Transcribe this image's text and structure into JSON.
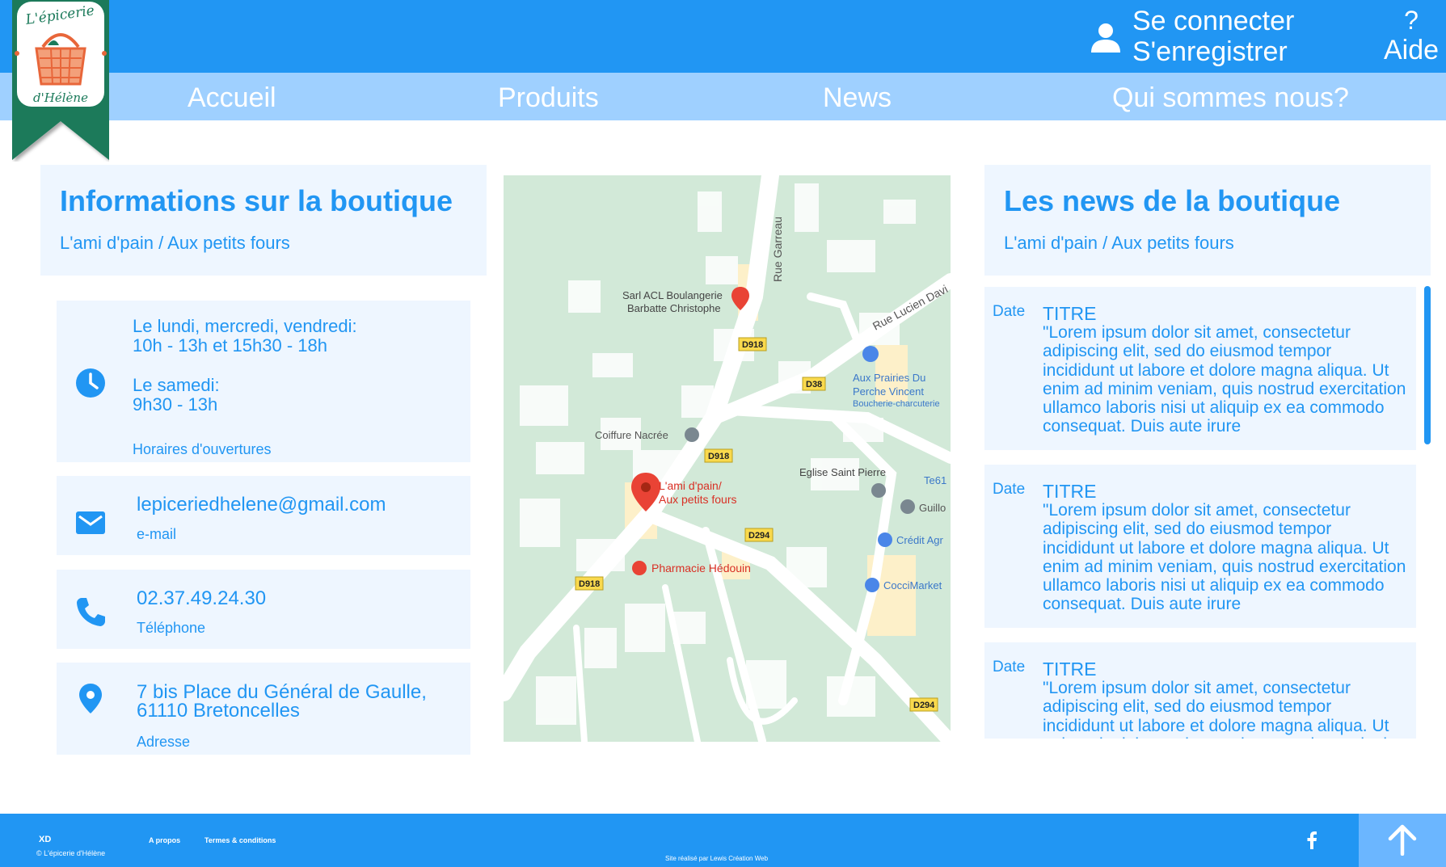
{
  "header": {
    "login_label": "Se connecter",
    "register_label": "S'enregistrer",
    "help_symbol": "?",
    "help_label": "Aide",
    "user_icon": "user-icon"
  },
  "nav": {
    "items": [
      "Accueil",
      "Produits",
      "News",
      "Qui sommes nous?"
    ]
  },
  "logo": {
    "line1": "L'épicerie",
    "line2": "d'Hélène"
  },
  "info": {
    "title": "Informations sur la boutique",
    "subtitle": "L'ami d'pain / Aux petits fours",
    "hours": {
      "line1": "Le lundi, mercredi, vendredi:",
      "line2": "10h - 13h et 15h30 - 18h",
      "line3": "Le samedi:",
      "line4": "9h30 - 13h",
      "caption": "Horaires d'ouvertures",
      "icon": "clock-icon"
    },
    "email": {
      "value": "lepiceriedhelene@gmail.com",
      "caption": "e-mail",
      "icon": "mail-icon"
    },
    "phone": {
      "value": "02.37.49.24.30",
      "caption": "Téléphone",
      "icon": "phone-icon"
    },
    "address": {
      "line1": "7 bis Place du Général de Gaulle,",
      "line2": "61110 Bretoncelles",
      "caption": "Adresse",
      "icon": "location-pin-icon"
    }
  },
  "map": {
    "street_garreau": "Rue Garreau",
    "street_lucien": "Rue Lucien Davi",
    "road_d918": "D918",
    "road_d38": "D38",
    "road_d294": "D294",
    "poi_boulangerie_1": "Sarl ACL Boulangerie",
    "poi_boulangerie_2": "Barbatte Christophe",
    "poi_prairies_1": "Aux Prairies Du",
    "poi_prairies_2": "Perche Vincent",
    "poi_prairies_3": "Boucherie-charcuterie",
    "poi_coiffure": "Coiffure Nacrée",
    "poi_shop_1": "L'ami d'pain/",
    "poi_shop_2": "Aux petits fours",
    "poi_eglise": "Eglise Saint Pierre",
    "poi_te": "Te61",
    "poi_guillo": "Guillo",
    "poi_credit": "Crédit Agr",
    "poi_pharmacie": "Pharmacie Hédouin",
    "poi_cocci": "CocciMarket"
  },
  "news": {
    "title": "Les news de la boutique",
    "subtitle": "L'ami d'pain / Aux petits fours",
    "items": [
      {
        "date": "Date",
        "title": "TITRE",
        "body": "\"Lorem ipsum dolor sit amet, consectetur adipiscing elit, sed do eiusmod tempor incididunt ut labore et dolore magna aliqua. Ut enim ad minim veniam, quis nostrud exercitation ullamco laboris nisi ut aliquip ex ea commodo consequat. Duis aute irure"
      },
      {
        "date": "Date",
        "title": "TITRE",
        "body": "\"Lorem ipsum dolor sit amet, consectetur adipiscing elit, sed do eiusmod tempor incididunt ut labore et dolore magna aliqua. Ut enim ad minim veniam, quis nostrud exercitation ullamco laboris nisi ut aliquip ex ea commodo consequat. Duis aute irure"
      },
      {
        "date": "Date",
        "title": "TITRE",
        "body": "\"Lorem ipsum dolor sit amet, consectetur adipiscing elit, sed do eiusmod tempor incididunt ut labore et dolore magna aliqua. Ut enim ad minim veniam, quis nostrud exercitation ullamco laboris nisi ut aliquip ex ea commodo consequat. Duis aute irure"
      }
    ]
  },
  "footer": {
    "xd": "XD",
    "copyright": "© L'épicerie d'Hélène",
    "about": "A propos",
    "terms": "Termes & conditions",
    "credit": "Site réalisé par Lewis Création Web",
    "facebook_icon": "facebook-icon",
    "top_icon": "arrow-up-icon"
  },
  "colors": {
    "primary": "#2196f3",
    "nav": "#9fd0ff",
    "panel": "#eef6ff",
    "logo_green": "#1b7a5a",
    "logo_orange": "#e8663a"
  }
}
